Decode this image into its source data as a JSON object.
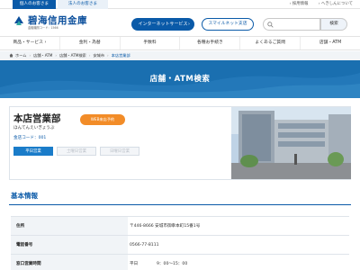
{
  "top_tabs": {
    "personal": "個人のお客さま",
    "corporate": "法人のお客さま"
  },
  "top_links": {
    "recruit": "› 採用情報",
    "about": "› へきしんについて"
  },
  "logo": {
    "name": "碧海信用金庫",
    "sub": "金融機関コード：1566"
  },
  "header_buttons": {
    "internet_service": "インターネットサービス",
    "smart_app": "スマイルネット支店"
  },
  "search": {
    "placeholder": "",
    "button": "検索"
  },
  "global_nav": [
    "商品・サービス ›",
    "金利・為替",
    "手数料",
    "各種お手続き",
    "よくあるご質問",
    "店舗・ATM"
  ],
  "breadcrumb": [
    "ホーム",
    "店舗・ATM",
    "店舗・ATM検索",
    "安城市",
    "本店営業部"
  ],
  "hero": {
    "title": "店舗・ATM検索"
  },
  "branch": {
    "name": "本店営業部",
    "kana": "ほんてんえいぎょうぶ",
    "code": "金店コード：001",
    "reserve_button": "WEB来店予約",
    "tags": [
      "平日営業",
      "土曜日営業",
      "日曜日営業"
    ]
  },
  "basic_info": {
    "title": "基本情報",
    "rows": [
      {
        "label": "住所",
        "value": "〒446-8666 安城市御幸本町15番1号"
      },
      {
        "label": "電話番号",
        "value": "0566-77-8111"
      },
      {
        "label": "窓口営業時間",
        "day": "平日",
        "time": "9：00～15：00"
      }
    ]
  },
  "colors": {
    "brand": "#0a5aa8",
    "hero": "#1a6fb0",
    "reserve": "#f28c28"
  }
}
